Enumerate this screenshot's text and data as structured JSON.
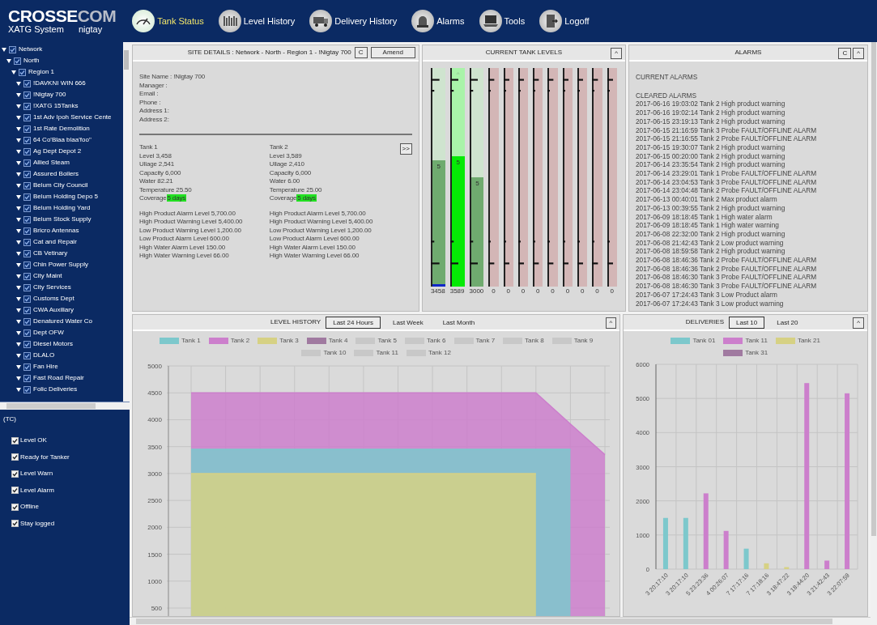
{
  "header": {
    "brand": {
      "main": "CROSSE",
      "accent": "COM"
    },
    "subtitle": "XATG System",
    "user": "nigtay",
    "nav": [
      {
        "label": "Tank Status",
        "kind": "gauge",
        "selected": true
      },
      {
        "label": "Level History",
        "kind": "bars",
        "selected": false
      },
      {
        "label": "Delivery History",
        "kind": "truck",
        "selected": false
      },
      {
        "label": "Alarms",
        "kind": "alarm",
        "selected": false
      },
      {
        "label": "Tools",
        "kind": "laptop",
        "selected": false
      },
      {
        "label": "Logoff",
        "kind": "door",
        "selected": false
      }
    ]
  },
  "sidebar": {
    "tree": [
      {
        "label": "Network",
        "expanded": true,
        "checked": true,
        "children": [
          {
            "label": "North",
            "expanded": true,
            "checked": true,
            "children": [
              {
                "label": "Region 1",
                "expanded": true,
                "checked": true,
                "children": [
                  {
                    "label": "!DAVKNI WIN 666",
                    "expanded": true,
                    "checked": true
                  },
                  {
                    "label": "!Nigtay 700",
                    "expanded": true,
                    "checked": true
                  },
                  {
                    "label": "!XATG 15Tanks",
                    "expanded": true,
                    "checked": true
                  },
                  {
                    "label": "1st Adv Ipoh Service Cente",
                    "expanded": true,
                    "checked": true
                  },
                  {
                    "label": "1st Rate Demolition",
                    "expanded": true,
                    "checked": true
                  },
                  {
                    "label": "64 Co'Blaa blaa'foo\"",
                    "expanded": true,
                    "checked": true
                  },
                  {
                    "label": "Ag Dept Depot 2",
                    "expanded": true,
                    "checked": true
                  },
                  {
                    "label": "Allied Steam",
                    "expanded": true,
                    "checked": true
                  },
                  {
                    "label": "Assured Boilers",
                    "expanded": true,
                    "checked": true
                  },
                  {
                    "label": "Belum City Council",
                    "expanded": true,
                    "checked": true
                  },
                  {
                    "label": "Belum Holding Depo 5",
                    "expanded": true,
                    "checked": true
                  },
                  {
                    "label": "Belum Holding Yard",
                    "expanded": true,
                    "checked": true
                  },
                  {
                    "label": "Belum Stock Supply",
                    "expanded": true,
                    "checked": true
                  },
                  {
                    "label": "Bricro Antennas",
                    "expanded": true,
                    "checked": true
                  },
                  {
                    "label": "Cat and Repair",
                    "expanded": true,
                    "checked": true
                  },
                  {
                    "label": "CB Vetinary",
                    "expanded": true,
                    "checked": true
                  },
                  {
                    "label": "Chin Power Supply",
                    "expanded": true,
                    "checked": true
                  },
                  {
                    "label": "City Maint",
                    "expanded": true,
                    "checked": true
                  },
                  {
                    "label": "City Services",
                    "expanded": true,
                    "checked": true
                  },
                  {
                    "label": "Customs Dept",
                    "expanded": true,
                    "checked": true
                  },
                  {
                    "label": "CWA Auxiliary",
                    "expanded": true,
                    "checked": true
                  },
                  {
                    "label": "Denatured Water Co",
                    "expanded": true,
                    "checked": true
                  },
                  {
                    "label": "Dept OFW",
                    "expanded": true,
                    "checked": true
                  },
                  {
                    "label": "Diesel Motors",
                    "expanded": true,
                    "checked": true
                  },
                  {
                    "label": "DLALO",
                    "expanded": true,
                    "checked": true
                  },
                  {
                    "label": "Fan Hire",
                    "expanded": true,
                    "checked": true
                  },
                  {
                    "label": "Fast Road Repair",
                    "expanded": true,
                    "checked": true
                  },
                  {
                    "label": "Folic Deliveries",
                    "expanded": true,
                    "checked": true
                  }
                ]
              }
            ]
          }
        ]
      }
    ],
    "legend_title": "(TC)",
    "legend": [
      {
        "label": "Level OK",
        "checked": true
      },
      {
        "label": "Ready for Tanker",
        "checked": true
      },
      {
        "label": "Level Warn",
        "checked": true
      },
      {
        "label": "Level Alarm",
        "checked": true
      },
      {
        "label": "Offline",
        "checked": true
      },
      {
        "label": "Stay logged",
        "checked": true
      }
    ]
  },
  "site_details": {
    "title": "SITE DETAILS : Network - North - Region 1 - !Nigtay 700",
    "clear_button": "C",
    "amend_button": "Amend",
    "info": [
      "Site Name : !Nigtay 700",
      "Manager :",
      "Email :",
      "Phone :",
      "Address 1:",
      "Address 2:"
    ],
    "next_button": ">>",
    "tanks": [
      {
        "name": "Tank 1",
        "readings": [
          "Level 3,458",
          "Ullage 2,541",
          "Capacity 6,000",
          "Water 82.21",
          "Temperature 25.50"
        ],
        "coverage_label": "Coverage",
        "coverage": "5 days",
        "thresholds": [
          "High Product Alarm Level 5,700.00",
          "High Product Warning Level 5,400.00",
          "Low Product Warning Level 1,200.00",
          "Low Product Alarm Level 600.00",
          "High Water Alarm Level 150.00",
          "High Water Warning Level 66.00"
        ]
      },
      {
        "name": "Tank 2",
        "readings": [
          "Level 3,589",
          "Ullage 2,410",
          "Capacity 6,000",
          "Water 6.00",
          "Temperature 25.00"
        ],
        "coverage_label": "Coverage",
        "coverage": "5 days",
        "thresholds": [
          "High Product Alarm Level 5,700.00",
          "High Product Warning Level 5,400.00",
          "Low Product Warning Level 1,200.00",
          "Low Product Alarm Level 600.00",
          "High Water Alarm Level 150.00",
          "High Water Warning Level 66.00"
        ]
      }
    ]
  },
  "tank_levels": {
    "title": "CURRENT TANK LEVELS",
    "collapse_button": "^",
    "tanks": [
      {
        "kind": "ok",
        "level": 0.576,
        "days": "5",
        "reading": "3458",
        "water": true
      },
      {
        "kind": "filling",
        "level": 0.598,
        "days": "5",
        "reading": "3589",
        "top_mark": "^"
      },
      {
        "kind": "ok",
        "level": 0.5,
        "days": "5",
        "reading": "3000"
      },
      {
        "kind": "offline",
        "reading": "0"
      },
      {
        "kind": "offline",
        "reading": "0"
      },
      {
        "kind": "offline",
        "reading": "0"
      },
      {
        "kind": "offline",
        "reading": "0"
      },
      {
        "kind": "offline",
        "reading": "0"
      },
      {
        "kind": "offline",
        "reading": "0"
      },
      {
        "kind": "offline",
        "reading": "0"
      },
      {
        "kind": "offline",
        "reading": "0"
      },
      {
        "kind": "offline",
        "reading": "0"
      }
    ]
  },
  "alarms": {
    "title": "ALARMS",
    "clear_button": "C",
    "collapse_button": "^",
    "current_heading": "CURRENT ALARMS",
    "cleared_heading": "CLEARED ALARMS",
    "cleared": [
      "2017-06-16 19:03:02 Tank 2 High product warning",
      "2017-06-16 19:02:14 Tank 2 High product warning",
      "2017-06-15 23:19:13 Tank 2 High product warning",
      "2017-06-15 21:16:59 Tank 3 Probe FAULT/OFFLINE ALARM",
      "2017-06-15 21:16:55 Tank 2 Probe FAULT/OFFLINE ALARM",
      "2017-06-15 19:30:07 Tank 2 High product warning",
      "2017-06-15 00:20:00 Tank 2 High product warning",
      "2017-06-14 23:35:54 Tank 2 High product warning",
      "2017-06-14 23:29:01 Tank 1 Probe FAULT/OFFLINE ALARM",
      "2017-06-14 23:04:53 Tank 3 Probe FAULT/OFFLINE ALARM",
      "2017-06-14 23:04:48 Tank 2 Probe FAULT/OFFLINE ALARM",
      "2017-06-13 00:40:01 Tank 2 Max product alarm",
      "2017-06-13 00:39:55 Tank 2 High product warning",
      "2017-06-09 18:18:45 Tank 1 High water alarm",
      "2017-06-09 18:18:45 Tank 1 High water warning",
      "2017-06-08 22:32:00 Tank 2 High product warning",
      "2017-06-08 21:42:43 Tank 2 Low product warning",
      "2017-06-08 18:59:58 Tank 2 High product warning",
      "2017-06-08 18:46:36 Tank 2 Probe FAULT/OFFLINE ALARM",
      "2017-06-08 18:46:36 Tank 2 Probe FAULT/OFFLINE ALARM",
      "2017-06-08 18:46:30 Tank 3 Probe FAULT/OFFLINE ALARM",
      "2017-06-08 18:46:30 Tank 3 Probe FAULT/OFFLINE ALARM",
      "2017-06-07 17:24:43 Tank 3 Low Product alarm",
      "2017-06-07 17:24:43 Tank 3 Low product warning"
    ]
  },
  "level_history": {
    "title": "LEVEL HISTORY",
    "ranges": [
      {
        "label": "Last 24 Hours",
        "selected": true
      },
      {
        "label": "Last Week",
        "selected": false
      },
      {
        "label": "Last Month",
        "selected": false
      }
    ],
    "collapse_button": "^",
    "chart_data": {
      "type": "area",
      "categories": [
        null,
        null,
        null,
        null,
        null,
        null,
        null,
        null,
        null,
        null,
        null,
        null,
        null
      ],
      "grid": true,
      "ylim": [
        350,
        5000
      ],
      "yticks": [
        500,
        1000,
        1500,
        2000,
        2500,
        3000,
        3500,
        4000,
        4500,
        5000
      ],
      "series": [
        {
          "name": "Tank 1",
          "color": "#7dc8cc",
          "values": [
            3450,
            3450,
            3450,
            3450,
            3450,
            3450,
            3450,
            3450,
            3450,
            3450,
            3450,
            3450,
            null
          ]
        },
        {
          "name": "Tank 2",
          "color": "#cc7fcc",
          "values": [
            4500,
            4500,
            4500,
            4500,
            4500,
            4500,
            4500,
            4500,
            4500,
            4500,
            4500,
            3920,
            3350
          ]
        },
        {
          "name": "Tank 3",
          "color": "#d6d184",
          "values": [
            3000,
            3000,
            3000,
            3000,
            3000,
            3000,
            3000,
            3000,
            3000,
            3000,
            3000,
            null,
            null
          ]
        },
        {
          "name": "Tank 4",
          "color": "#a07aa0",
          "values": [
            null,
            null,
            null,
            null,
            null,
            null,
            null,
            null,
            null,
            null,
            null,
            null,
            null
          ]
        },
        {
          "name": "Tank 5",
          "color": "#c8c8c8",
          "values": [
            null,
            null,
            null,
            null,
            null,
            null,
            null,
            null,
            null,
            null,
            null,
            null,
            null
          ]
        },
        {
          "name": "Tank 6",
          "color": "#c8c8c8",
          "values": [
            null,
            null,
            null,
            null,
            null,
            null,
            null,
            null,
            null,
            null,
            null,
            null,
            null
          ]
        },
        {
          "name": "Tank 7",
          "color": "#c8c8c8",
          "values": [
            null,
            null,
            null,
            null,
            null,
            null,
            null,
            null,
            null,
            null,
            null,
            null,
            null
          ]
        },
        {
          "name": "Tank 8",
          "color": "#c8c8c8",
          "values": [
            null,
            null,
            null,
            null,
            null,
            null,
            null,
            null,
            null,
            null,
            null,
            null,
            null
          ]
        },
        {
          "name": "Tank 9",
          "color": "#c8c8c8",
          "values": [
            null,
            null,
            null,
            null,
            null,
            null,
            null,
            null,
            null,
            null,
            null,
            null,
            null
          ]
        },
        {
          "name": "Tank 10",
          "color": "#c8c8c8",
          "values": [
            null,
            null,
            null,
            null,
            null,
            null,
            null,
            null,
            null,
            null,
            null,
            null,
            null
          ]
        },
        {
          "name": "Tank 11",
          "color": "#c8c8c8",
          "values": [
            null,
            null,
            null,
            null,
            null,
            null,
            null,
            null,
            null,
            null,
            null,
            null,
            null
          ]
        },
        {
          "name": "Tank 12",
          "color": "#c8c8c8",
          "values": [
            null,
            null,
            null,
            null,
            null,
            null,
            null,
            null,
            null,
            null,
            null,
            null,
            null
          ]
        }
      ]
    }
  },
  "deliveries": {
    "title": "DELIVERIES",
    "ranges": [
      {
        "label": "Last 10",
        "selected": true
      },
      {
        "label": "Last 20",
        "selected": false
      }
    ],
    "collapse_button": "^",
    "chart_data": {
      "type": "bar",
      "grid": true,
      "categories": [
        "3 20:17:10",
        "3 20:17:10",
        "5 23:23:36",
        "4 00:26:07",
        "7 17:17:16",
        "7 17:18:16",
        "3 18:47:22",
        "3 18:44:20",
        "3 21:42:43",
        "3 22:07:59"
      ],
      "ylim": [
        0,
        6000
      ],
      "yticks": [
        0,
        1000,
        2000,
        3000,
        4000,
        5000,
        6000
      ],
      "series": [
        {
          "name": "Tank 01",
          "color": "#7dc8cc",
          "values": [
            1500,
            1500,
            null,
            null,
            600,
            null,
            null,
            null,
            null,
            null
          ]
        },
        {
          "name": "Tank 11",
          "color": "#cc7fcc",
          "values": [
            null,
            null,
            2220,
            1120,
            null,
            null,
            null,
            5450,
            250,
            5150
          ]
        },
        {
          "name": "Tank 21",
          "color": "#d6d184",
          "values": [
            null,
            null,
            null,
            null,
            null,
            170,
            60,
            null,
            null,
            null
          ]
        },
        {
          "name": "Tank 31",
          "color": "#a07aa0",
          "values": [
            null,
            null,
            null,
            null,
            null,
            null,
            null,
            null,
            null,
            null
          ]
        }
      ]
    }
  }
}
